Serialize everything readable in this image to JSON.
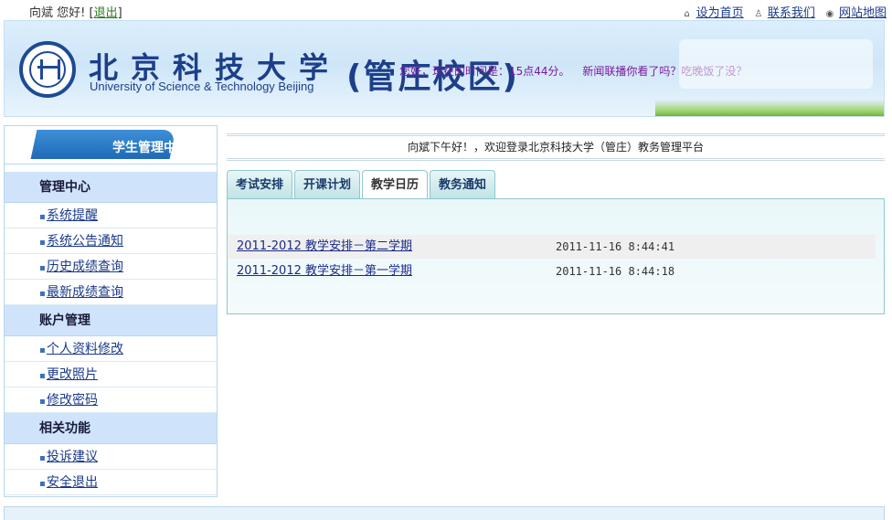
{
  "topbar": {
    "user": "向斌",
    "greeting": "您好!",
    "logout_label": "退出",
    "links": [
      "设为首页",
      "联系我们",
      "网站地图"
    ]
  },
  "banner": {
    "university_cn": "北京科技大学",
    "university_en": "University of Science & Technology Beijing",
    "campus": "(管庄校区)",
    "ticker": "您好，现在的时间是：15点44分。",
    "news": "新闻联播你看了吗？吃晚饭了没？"
  },
  "sidebar": {
    "title": "学生管理中心",
    "groups": [
      {
        "label": "管理中心",
        "items": [
          "系统提醒",
          "系统公告通知",
          "历史成绩查询",
          "最新成绩查询"
        ]
      },
      {
        "label": "账户管理",
        "items": [
          "个人资料修改",
          "更改照片",
          "修改密码"
        ]
      },
      {
        "label": "相关功能",
        "items": [
          "投诉建议",
          "安全退出"
        ]
      }
    ]
  },
  "main": {
    "welcome": "向斌下午好！，欢迎登录北京科技大学（管庄）教务管理平台",
    "tabs": [
      {
        "label": "考试安排",
        "active": false
      },
      {
        "label": "开课计划",
        "active": false
      },
      {
        "label": "教学日历",
        "active": true
      },
      {
        "label": "教务通知",
        "active": false
      }
    ],
    "rows": [
      {
        "title": "2011-2012 教学安排－第二学期",
        "time": "2011-11-16 8:44:41"
      },
      {
        "title": "2011-2012 教学安排－第一学期",
        "time": "2011-11-16 8:44:18"
      }
    ]
  },
  "icons": {
    "home": "home-icon",
    "contact": "person-icon",
    "sitemap": "globe-icon"
  },
  "colors": {
    "brand": "#1d3f8a",
    "sidebar_group_bg": "#cfe4fa",
    "tab_border": "#8ec7cf",
    "link": "#1a3a8a"
  }
}
